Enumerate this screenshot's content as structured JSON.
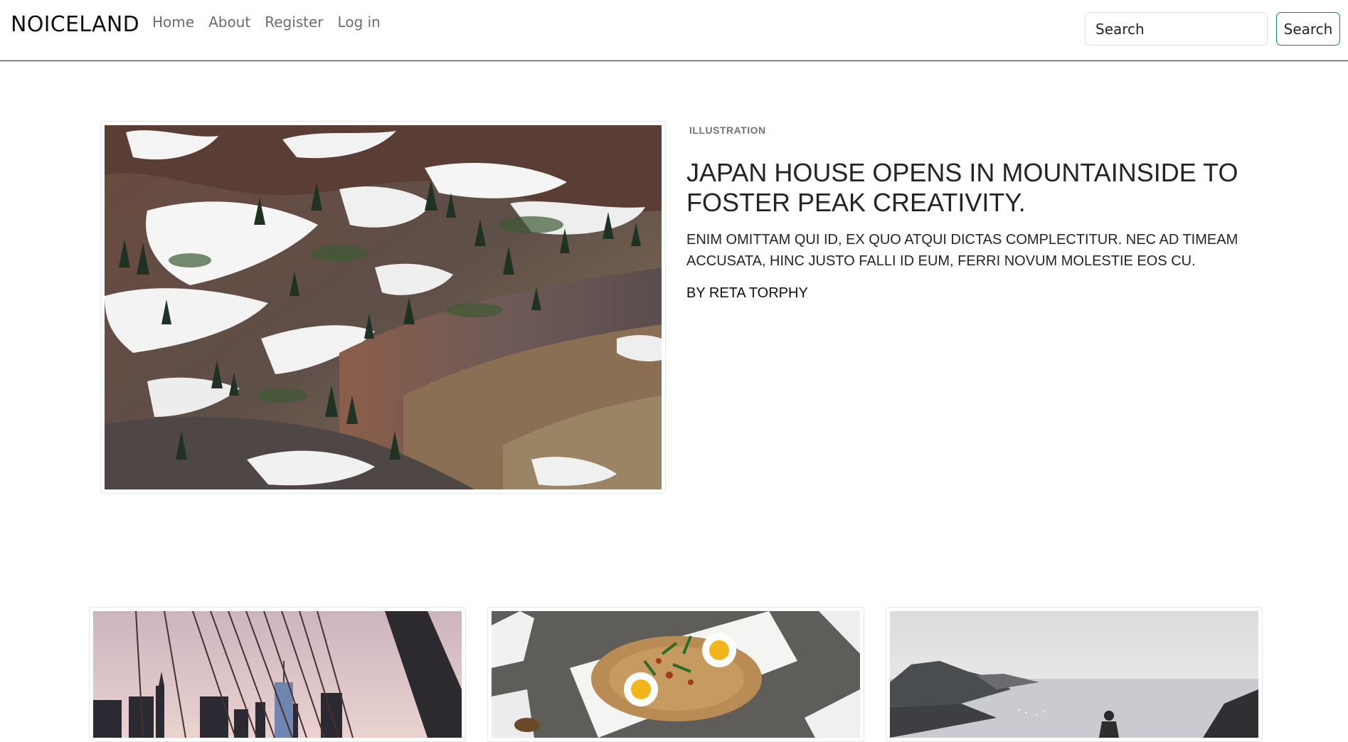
{
  "navbar": {
    "brand": "NOICELAND",
    "links": [
      {
        "label": "Home"
      },
      {
        "label": "About"
      },
      {
        "label": "Register"
      },
      {
        "label": "Log in"
      }
    ],
    "search": {
      "placeholder": "Search",
      "button_label": "Search"
    }
  },
  "featured": {
    "image": "mountain-snow-photo",
    "category": "ILLUSTRATION",
    "title": "JAPAN HOUSE OPENS IN MOUNTAINSIDE TO FOSTER PEAK CREATIVITY.",
    "excerpt": "ENIM OMITTAM QUI ID, EX QUO ATQUI DICTAS COMPLECTITUR. NEC AD TIMEAM ACCUSATA, HINC JUSTO FALLI ID EUM, FERRI NOVUM MOLESTIE EOS CU.",
    "author": "BY RETA TORPHY"
  },
  "cards": [
    {
      "image": "bridge-city-photo"
    },
    {
      "image": "food-plate-photo"
    },
    {
      "image": "coastal-mountain-photo"
    }
  ],
  "colors": {
    "accent": "#198754",
    "text": "#212529",
    "muted": "#6c757d"
  }
}
